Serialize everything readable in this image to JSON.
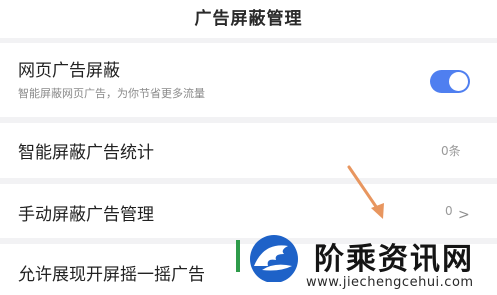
{
  "header": {
    "title": "广告屏蔽管理"
  },
  "rows": [
    {
      "title": "网页广告屏蔽",
      "subtitle": "智能屏蔽网页广告，为你节省更多流量",
      "toggle_on": true
    },
    {
      "title": "智能屏蔽广告统计",
      "value": "0条"
    },
    {
      "title": "手动屏蔽广告管理",
      "value": "0",
      "chevron": ">"
    },
    {
      "title": "允许展现开屏摇一摇广告"
    }
  ],
  "watermark": {
    "logo_text": "阶乘资讯网",
    "url": "www.jiechengcehui.com"
  },
  "colors": {
    "toggle_accent": "#4f7ff0",
    "annotation_arrow": "#e8965f",
    "logo_blue": "#1e62c8"
  },
  "icons": {
    "watermark_logo": "eagle-logo-icon",
    "chevron": "chevron-right-icon",
    "arrow": "annotation-arrow-icon"
  }
}
